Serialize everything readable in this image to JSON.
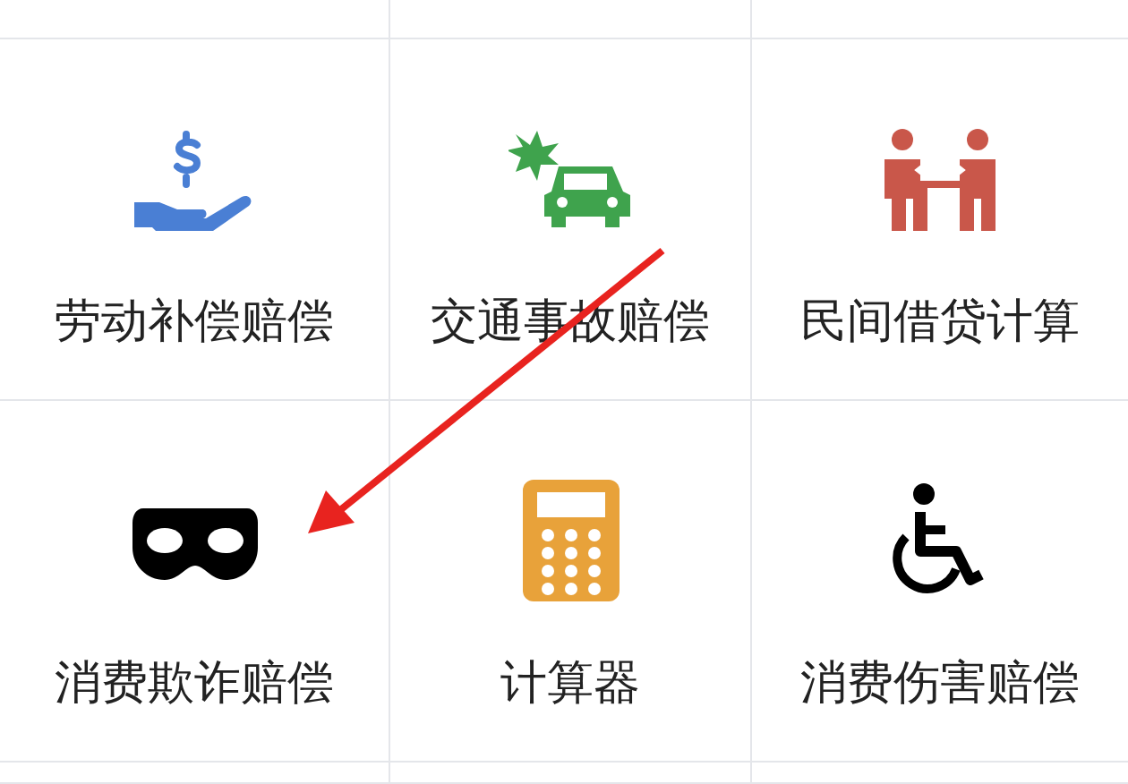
{
  "grid": {
    "items": [
      {
        "label": "劳动补偿赔偿"
      },
      {
        "label": "交通事故赔偿"
      },
      {
        "label": "民间借贷计算"
      },
      {
        "label": "消费欺诈赔偿"
      },
      {
        "label": "计算器"
      },
      {
        "label": "消费伤害赔偿"
      }
    ]
  }
}
